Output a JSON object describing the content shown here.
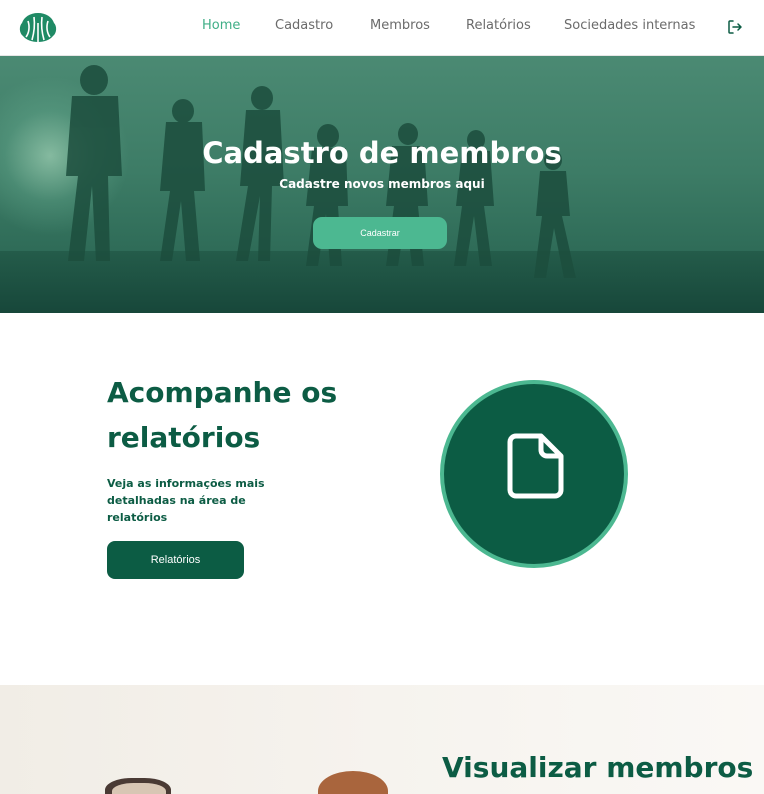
{
  "nav": {
    "items": [
      {
        "label": "Home",
        "active": true
      },
      {
        "label": "Cadastro",
        "active": false
      },
      {
        "label": "Membros",
        "active": false
      },
      {
        "label": "Relatórios",
        "active": false
      },
      {
        "label": "Sociedades internas",
        "active": false
      }
    ],
    "logout_icon": "logout-icon",
    "logo_icon": "tree-logo-icon"
  },
  "hero": {
    "title": "Cadastro de membros",
    "subtitle": "Cadastre novos membros aqui",
    "button_label": "Cadastrar"
  },
  "reports": {
    "title": "Acompanhe os relatórios",
    "description": "Veja as informações mais detalhadas na área de relatórios",
    "button_label": "Relatórios",
    "icon": "document-icon"
  },
  "members": {
    "title": "Visualizar membros"
  },
  "colors": {
    "primary": "#0c5c44",
    "accent": "#4cb891",
    "nav_active": "#3fae86"
  }
}
